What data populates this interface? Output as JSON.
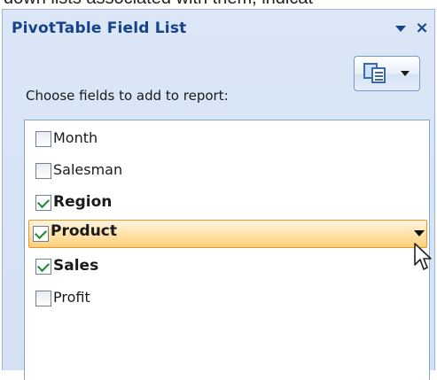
{
  "caption_cropped": "down lists associated with them, indicat",
  "panel": {
    "title": "PivotTable Field List",
    "prompt": "Choose fields to add to report:"
  },
  "icons": {
    "dropdown": "triangle-down-icon",
    "close": "close-icon",
    "layout": "field-list-layout-icon",
    "cursor": "mouse-pointer-icon"
  },
  "colors": {
    "title": "#15428b",
    "pane_bg": "#d3e1f3",
    "highlight": "#ffcf7a",
    "check": "#1f8a2e"
  },
  "fields": [
    {
      "label": "Month",
      "checked": false,
      "bold": false
    },
    {
      "label": "Salesman",
      "checked": false,
      "bold": false
    },
    {
      "label": "Region",
      "checked": true,
      "bold": true
    },
    {
      "label": "Product",
      "checked": true,
      "bold": true,
      "highlighted": true
    },
    {
      "label": "Sales",
      "checked": true,
      "bold": true
    },
    {
      "label": "Profit",
      "checked": false,
      "bold": false
    }
  ]
}
